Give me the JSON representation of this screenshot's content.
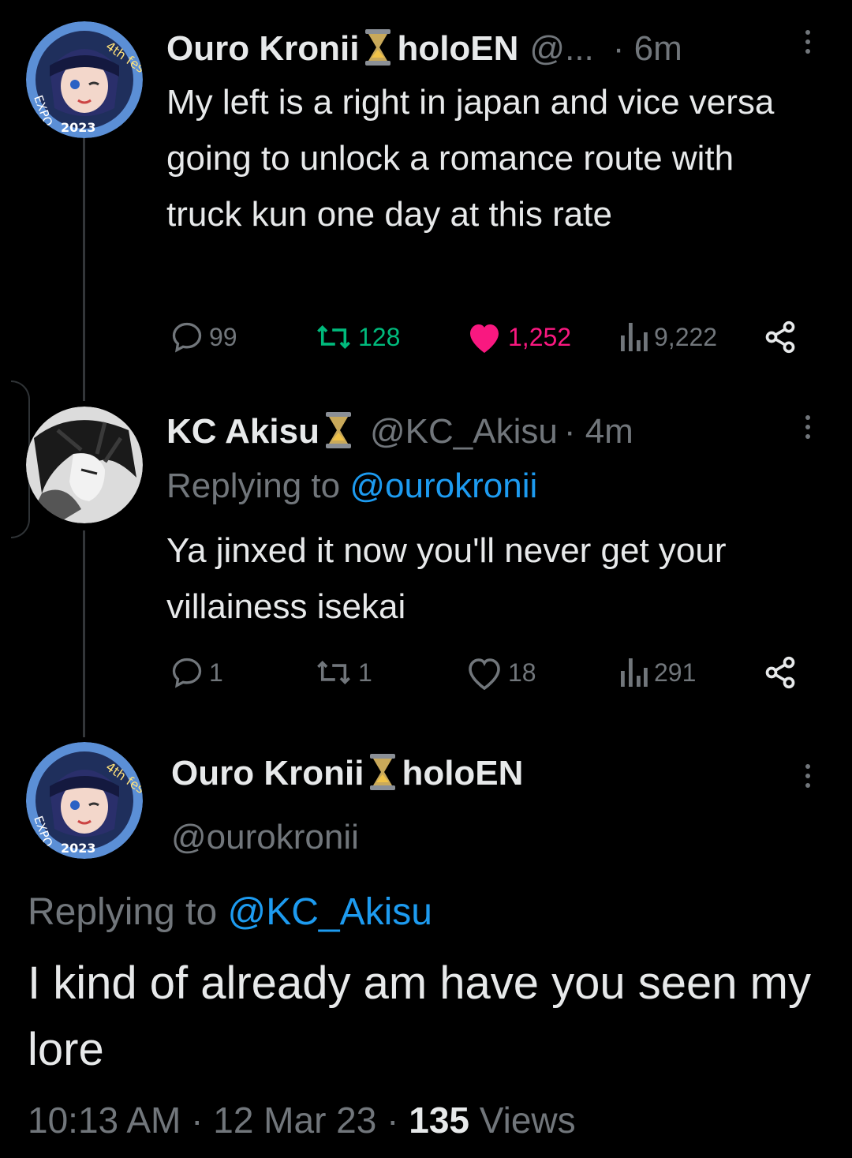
{
  "tweet1": {
    "name": "Ouro Kronii",
    "name_suffix": "holoEN",
    "handle": "@...",
    "time": "· 6m",
    "text": "My left is a right in japan and vice versa going to unlock a romance route with truck kun one day at this rate",
    "replies": "99",
    "retweets": "128",
    "likes": "1,252",
    "views": "9,222"
  },
  "tweet2": {
    "name": "KC Akisu",
    "handle": "@KC_Akisu",
    "time": "· 4m",
    "replying_label": "Replying to",
    "replying_to": "@ourokronii",
    "text": "Ya jinxed it now you'll never get your villainess isekai",
    "replies": "1",
    "retweets": "1",
    "likes": "18",
    "views": "291"
  },
  "tweet3": {
    "name": "Ouro Kronii",
    "name_suffix": "holoEN",
    "handle": "@ourokronii",
    "replying_label": "Replying to",
    "replying_to": "@KC_Akisu",
    "text": "I kind of already am have you seen my lore",
    "timestamp": "10:13 AM · 12 Mar 23 ·",
    "views_count": "135",
    "views_label": "Views"
  },
  "avatar_badge": {
    "top": "4th fes",
    "side": "EXPO",
    "bottom": "2023"
  },
  "colors": {
    "background": "#000000",
    "text": "#e7e9ea",
    "muted": "#71767b",
    "link": "#1d9bf0",
    "retweet": "#00ba7c",
    "like": "#f91880"
  },
  "icons": [
    "reply-icon",
    "retweet-icon",
    "heart-icon",
    "views-icon",
    "share-icon",
    "more-icon",
    "hourglass-icon"
  ]
}
